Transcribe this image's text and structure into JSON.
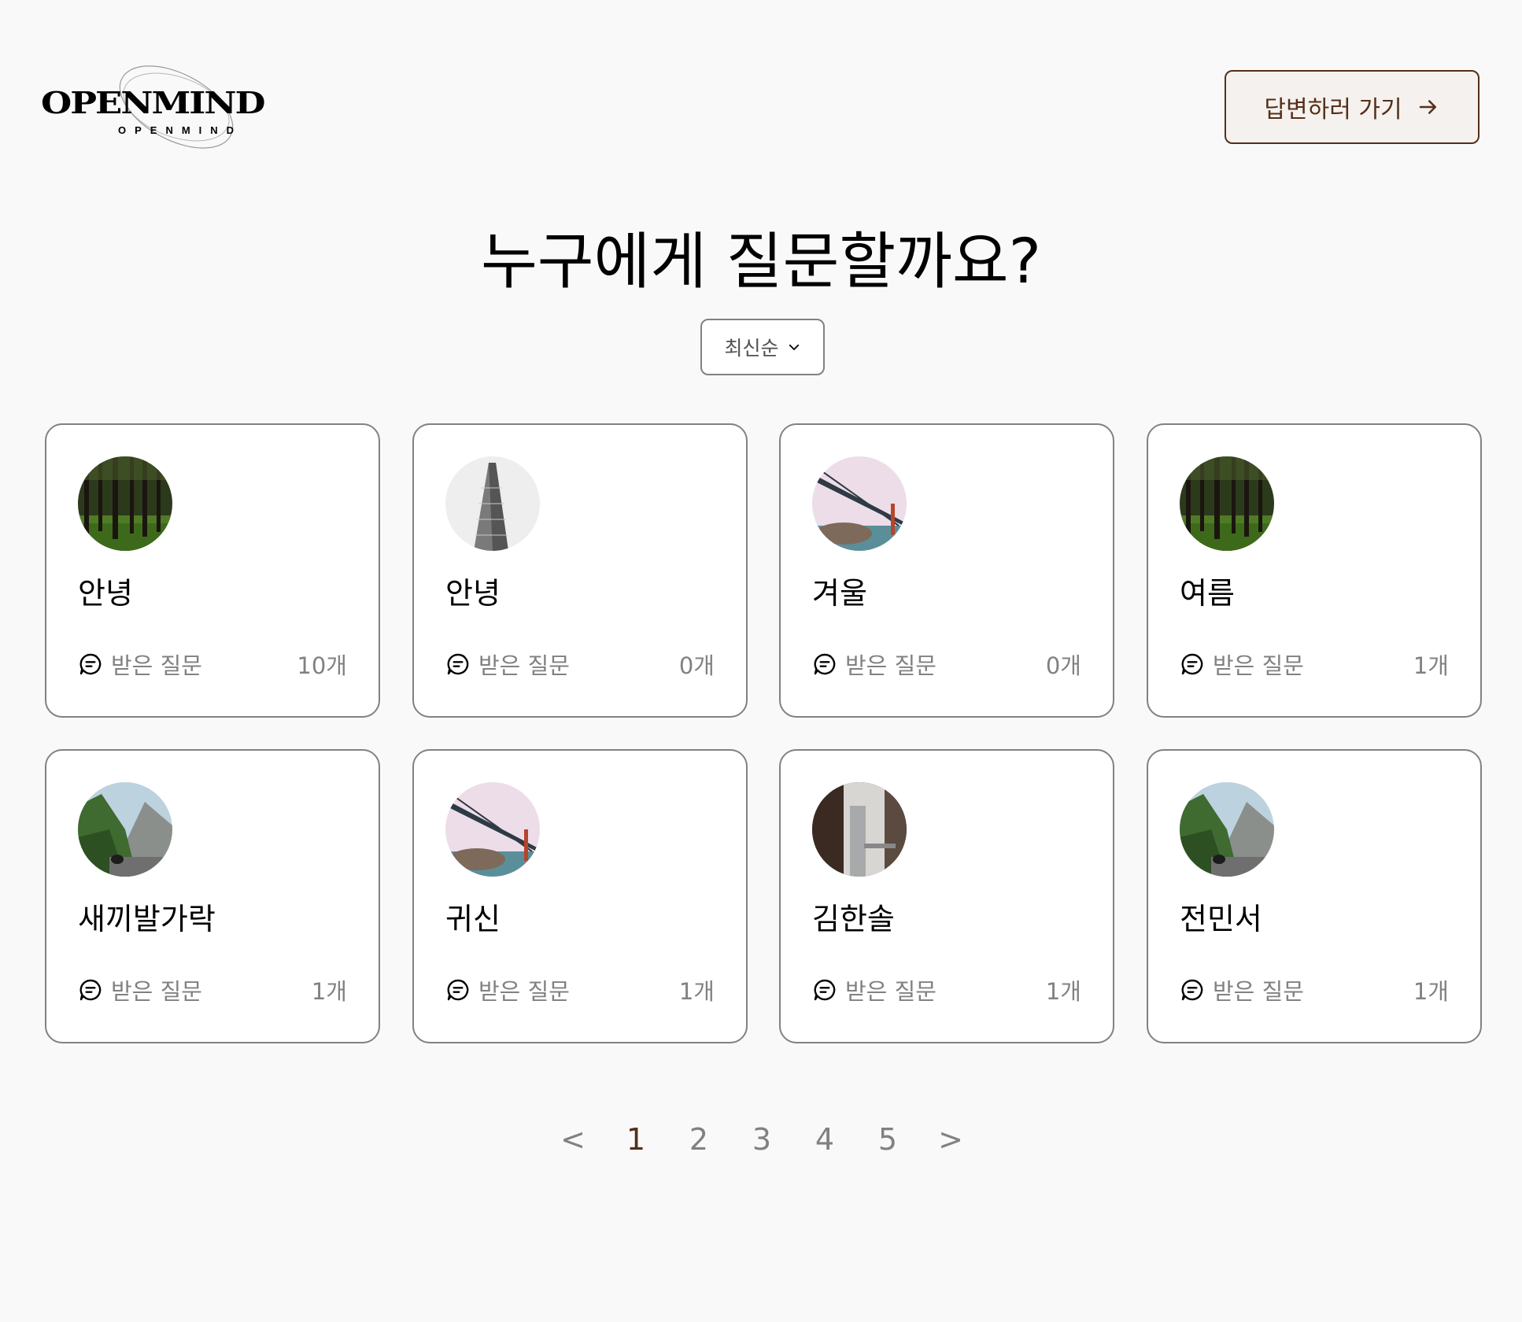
{
  "header": {
    "logo_text": "OPENMIND",
    "logo_subtext": "OPENMIND",
    "answer_button_label": "답변하러 가기"
  },
  "main": {
    "title": "누구에게 질문할까요?",
    "sort": {
      "selected": "최신순"
    }
  },
  "cards": [
    {
      "name": "안녕",
      "stat_label": "받은 질문",
      "count": "10개",
      "avatar": "forest"
    },
    {
      "name": "안녕",
      "stat_label": "받은 질문",
      "count": "0개",
      "avatar": "building"
    },
    {
      "name": "겨울",
      "stat_label": "받은 질문",
      "count": "0개",
      "avatar": "bridge"
    },
    {
      "name": "여름",
      "stat_label": "받은 질문",
      "count": "1개",
      "avatar": "forest"
    },
    {
      "name": "새끼발가락",
      "stat_label": "받은 질문",
      "count": "1개",
      "avatar": "mountain"
    },
    {
      "name": "귀신",
      "stat_label": "받은 질문",
      "count": "1개",
      "avatar": "bridge"
    },
    {
      "name": "김한솔",
      "stat_label": "받은 질문",
      "count": "1개",
      "avatar": "window"
    },
    {
      "name": "전민서",
      "stat_label": "받은 질문",
      "count": "1개",
      "avatar": "mountain"
    }
  ],
  "pagination": {
    "prev": "<",
    "pages": [
      "1",
      "2",
      "3",
      "4",
      "5"
    ],
    "current": "1",
    "next": ">"
  },
  "colors": {
    "accent": "#542f1a",
    "gray": "#818181",
    "background": "#f9f9f9"
  }
}
